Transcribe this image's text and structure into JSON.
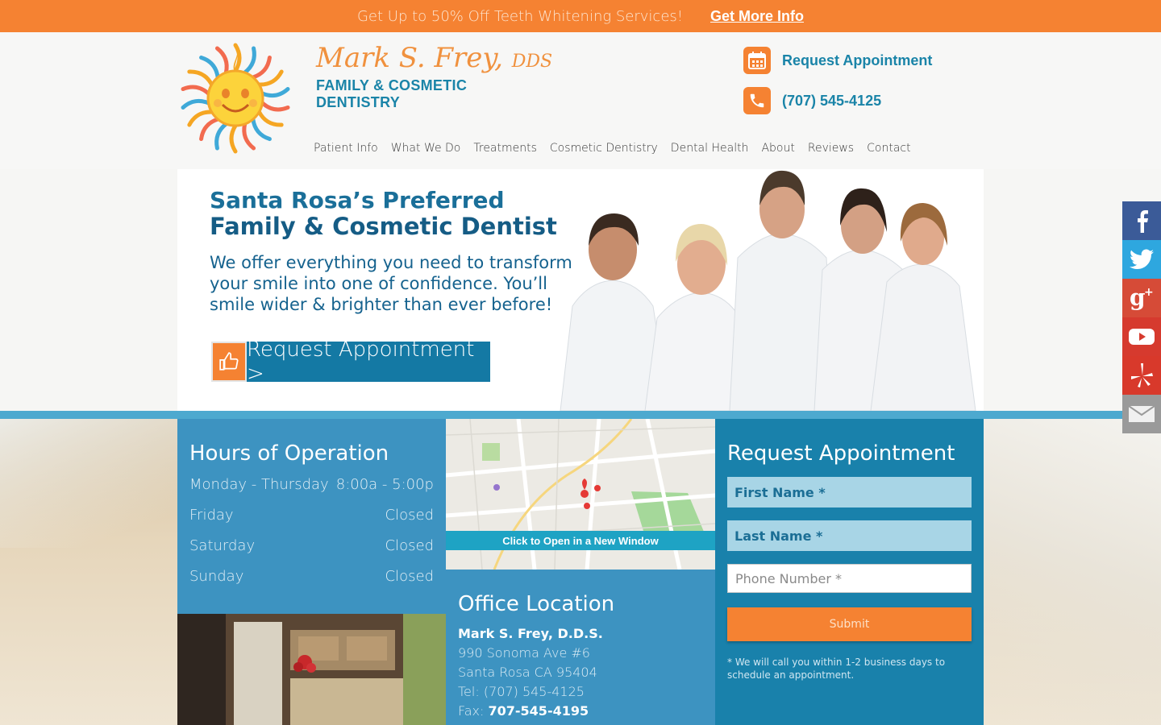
{
  "promo": {
    "text": "Get Up to 50% Off Teeth Whitening Services!",
    "link": "Get More Info"
  },
  "brand": {
    "name": "Mark S. Frey,",
    "suffix": "DDS",
    "tagline_1": "FAMILY & COSMETIC",
    "tagline_2": "DENTISTRY"
  },
  "header": {
    "appointment_label": "Request Appointment",
    "phone": "(707) 545-4125"
  },
  "nav": [
    "Patient Info",
    "What We Do",
    "Treatments",
    "Cosmetic Dentistry",
    "Dental Health",
    "About",
    "Reviews",
    "Contact"
  ],
  "hero": {
    "title_1": "Santa Rosa’s Preferred",
    "title_2": "Family & Cosmetic Dentist",
    "lead": "We offer everything you need to transform your smile into one of confidence. You’ll smile wider & brighter than ever before!",
    "cta": "Request Appointment >"
  },
  "hours": {
    "title": "Hours of Operation",
    "rows": [
      {
        "day": "Monday - Thursday",
        "time": "8:00a - 5:00p"
      },
      {
        "day": "Friday",
        "time": "Closed"
      },
      {
        "day": "Saturday",
        "time": "Closed"
      },
      {
        "day": "Sunday",
        "time": "Closed"
      }
    ]
  },
  "map": {
    "bar_label": "Click to Open in a New Window"
  },
  "office": {
    "title": "Office Location",
    "name": "Mark S. Frey, D.D.S.",
    "address_1": "990 Sonoma Ave #6",
    "address_2": "Santa Rosa CA 95404",
    "tel_label": "Tel:",
    "tel": "(707) 545-4125",
    "fax_label": "Fax:",
    "fax": "707-545-4195"
  },
  "form": {
    "title": "Request Appointment",
    "first_name": "First Name *",
    "last_name": "Last Name *",
    "phone_placeholder": "Phone Number *",
    "submit": "Submit",
    "note": "* We will call you within 1-2 business days to schedule an appointment."
  },
  "social": [
    {
      "icon": "facebook-icon",
      "color": "#3b5b98"
    },
    {
      "icon": "twitter-icon",
      "color": "#2ea7df"
    },
    {
      "icon": "google-plus-icon",
      "color": "#d64b37"
    },
    {
      "icon": "youtube-icon",
      "color": "#d63a2e"
    },
    {
      "icon": "yelp-icon",
      "color": "#d8392b"
    },
    {
      "icon": "email-icon",
      "color": "#9a9a9a"
    }
  ],
  "colors": {
    "accent_orange": "#f58232",
    "brand_blue": "#1981ab",
    "panel_blue": "#3d93c1"
  }
}
